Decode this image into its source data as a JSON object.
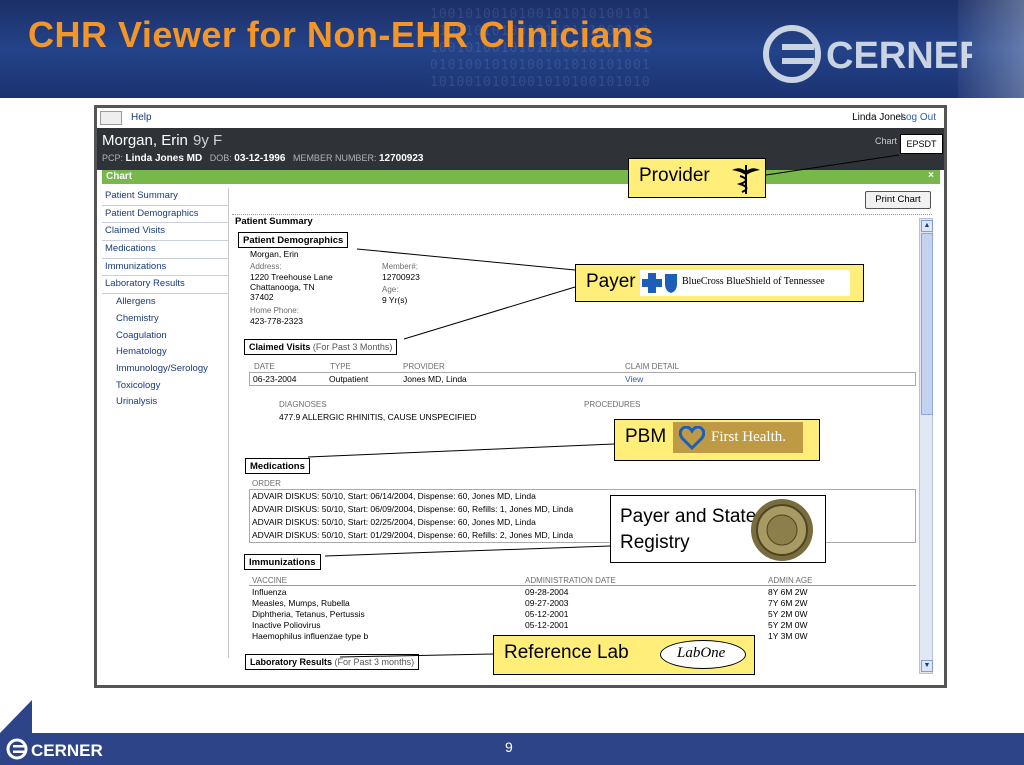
{
  "slide": {
    "title": "CHR Viewer for Non-EHR Clinicians",
    "brand": "CERNER",
    "page_number": "9"
  },
  "app": {
    "help_label": "Help",
    "user_name": "Linda Jones",
    "logout_label": "Log Out",
    "patient": {
      "name": "Morgan, Erin",
      "age_sex": "9y F",
      "pcp_label": "PCP:",
      "pcp": "Linda Jones MD",
      "dob_label": "DOB:",
      "dob": "03-12-1996",
      "member_label": "MEMBER NUMBER:",
      "member_number": "12700923"
    },
    "chart_label": "Chart",
    "epsdt_label": "EPSDT",
    "tab_label": "Chart",
    "close_label": "×",
    "nav_items": [
      "Patient Summary",
      "Patient Demographics",
      "Claimed Visits",
      "Medications",
      "Immunizations",
      "Laboratory Results"
    ],
    "nav_subitems": [
      "Allergens",
      "Chemistry",
      "Coagulation",
      "Hematology",
      "Immunology/Serology",
      "Toxicology",
      "Urinalysis"
    ],
    "print_label": "Print Chart",
    "summary_title": "Patient Summary",
    "demographics": {
      "title": "Patient Demographics",
      "name": "Morgan, Erin",
      "address_label": "Address:",
      "address1": "1220 Treehouse Lane",
      "address2": "Chattanooga, TN",
      "address3": "37402",
      "phone_label": "Home Phone:",
      "phone": "423-778-2323",
      "member_label": "Member#:",
      "member": "12700923",
      "age_label": "Age:",
      "age": "9 Yr(s)"
    },
    "claimed_visits": {
      "title": "Claimed Visits",
      "note": "(For Past 3 Months)",
      "headers": [
        "DATE",
        "TYPE",
        "PROVIDER",
        "CLAIM DETAIL"
      ],
      "row": [
        "06-23-2004",
        "Outpatient",
        "Jones MD, Linda",
        "View"
      ],
      "diagnoses_label": "DIAGNOSES",
      "procedures_label": "PROCEDURES",
      "diagnosis": "477.9 ALLERGIC RHINITIS, CAUSE UNSPECIFIED"
    },
    "medications": {
      "title": "Medications",
      "order_label": "ORDER",
      "rows": [
        "ADVAIR DISKUS: 50/10, Start: 06/14/2004, Dispense: 60, Jones MD, Linda",
        "ADVAIR DISKUS: 50/10, Start: 06/09/2004, Dispense: 60, Refills: 1, Jones MD, Linda",
        "ADVAIR DISKUS: 50/10, Start: 02/25/2004, Dispense: 60, Jones MD, Linda",
        "ADVAIR DISKUS: 50/10, Start: 01/29/2004, Dispense: 60, Refills: 2, Jones MD, Linda"
      ]
    },
    "immunizations": {
      "title": "Immunizations",
      "headers": [
        "VACCINE",
        "ADMINISTRATION DATE",
        "ADMIN AGE"
      ],
      "rows": [
        [
          "Influenza",
          "09-28-2004",
          "8Y 6M 2W"
        ],
        [
          "Measles, Mumps, Rubella",
          "09-27-2003",
          "7Y 6M 2W"
        ],
        [
          "Diphtheria, Tetanus, Pertussis",
          "05-12-2001",
          "5Y 2M 0W"
        ],
        [
          "Inactive Poliovirus",
          "05-12-2001",
          "5Y 2M 0W"
        ],
        [
          "Haemophilus influenzae type b",
          "",
          "1Y 3M 0W"
        ]
      ]
    },
    "lab_results": {
      "title": "Laboratory Results",
      "note": "(For Past 3 months)"
    }
  },
  "callouts": {
    "provider": "Provider",
    "payer": "Payer",
    "payer_logo_text": "BlueCross BlueShield of Tennessee",
    "pbm": "PBM",
    "pbm_logo_text": "First Health.",
    "state_registry": "Payer and State Registry",
    "reference_lab": "Reference Lab",
    "labone_text": "LabOne"
  },
  "colors": {
    "title_orange": "#f3962a",
    "banner_blue": "#24438a",
    "footer_blue": "#2d4488",
    "callout_yellow": "#ffef7a",
    "chart_green": "#78b84a"
  }
}
